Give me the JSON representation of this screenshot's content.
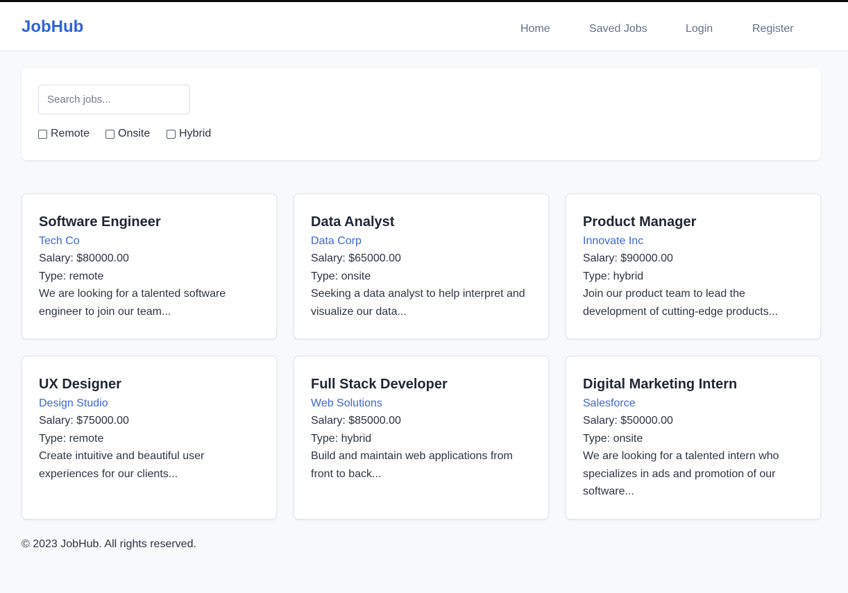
{
  "header": {
    "logo": "JobHub",
    "nav": [
      "Home",
      "Saved Jobs",
      "Login",
      "Register"
    ]
  },
  "search": {
    "placeholder": "Search jobs...",
    "value": "",
    "filters": [
      "Remote",
      "Onsite",
      "Hybrid"
    ]
  },
  "jobs": [
    {
      "title": "Software Engineer",
      "company": "Tech Co",
      "salary": "Salary: $80000.00",
      "type": "Type: remote",
      "description": "We are looking for a talented software engineer to join our team..."
    },
    {
      "title": "Data Analyst",
      "company": "Data Corp",
      "salary": "Salary: $65000.00",
      "type": "Type: onsite",
      "description": "Seeking a data analyst to help interpret and visualize our data..."
    },
    {
      "title": "Product Manager",
      "company": "Innovate Inc",
      "salary": "Salary: $90000.00",
      "type": "Type: hybrid",
      "description": "Join our product team to lead the development of cutting-edge products..."
    },
    {
      "title": "UX Designer",
      "company": "Design Studio",
      "salary": "Salary: $75000.00",
      "type": "Type: remote",
      "description": "Create intuitive and beautiful user experiences for our clients..."
    },
    {
      "title": "Full Stack Developer",
      "company": "Web Solutions",
      "salary": "Salary: $85000.00",
      "type": "Type: hybrid",
      "description": "Build and maintain web applications from front to back..."
    },
    {
      "title": "Digital Marketing Intern",
      "company": "Salesforce",
      "salary": "Salary: $50000.00",
      "type": "Type: onsite",
      "description": "We are looking for a talented intern who specializes in ads and promotion of our software..."
    }
  ],
  "footer": {
    "text": "© 2023 JobHub. All rights reserved."
  },
  "colors": {
    "brand": "#2f63d9",
    "company_link": "#3a66d6",
    "nav_text": "#64708a",
    "page_background": "#f8f9fb"
  }
}
